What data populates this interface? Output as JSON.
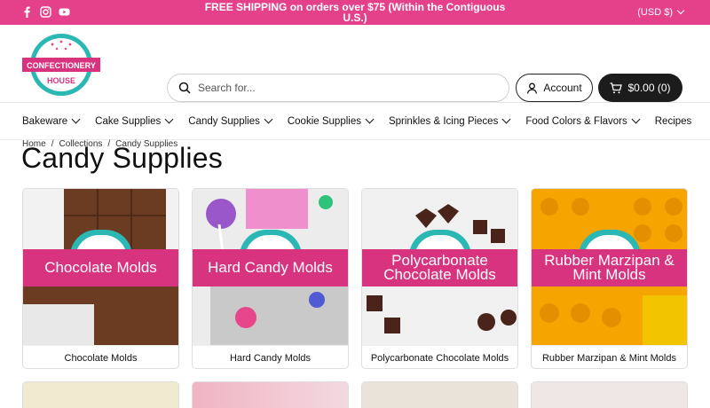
{
  "topbar": {
    "promo": "FREE SHIPPING on orders over $75 (Within the Contiguous U.S.)",
    "currency": "(USD $)",
    "social": [
      "facebook-icon",
      "instagram-icon",
      "youtube-icon"
    ]
  },
  "header": {
    "logo_line1": "CONFECTIONERY",
    "logo_line2": "HOUSE",
    "search_placeholder": "Search for...",
    "account_label": "Account",
    "cart_label": "$0.00 (0)"
  },
  "nav": {
    "items": [
      "Bakeware",
      "Cake Supplies",
      "Candy Supplies",
      "Cookie Supplies",
      "Sprinkles & Icing Pieces",
      "Food Colors & Flavors",
      "Recipes"
    ]
  },
  "breadcrumb": [
    "Home",
    "Collections",
    "Candy Supplies"
  ],
  "page_title": "Candy Supplies",
  "collections": [
    {
      "banner": "Chocolate Molds",
      "caption": "Chocolate Molds"
    },
    {
      "banner": "Hard Candy Molds",
      "caption": "Hard Candy Molds"
    },
    {
      "banner": "Polycarbonate Chocolate Molds",
      "caption": "Polycarbonate Chocolate Molds"
    },
    {
      "banner": "Rubber Marzipan & Mint Molds",
      "caption": "Rubber Marzipan & Mint Molds"
    }
  ],
  "colors": {
    "brand_pink": "#e5418b",
    "banner_pink": "#d8337f",
    "teal": "#2bb7b3"
  }
}
